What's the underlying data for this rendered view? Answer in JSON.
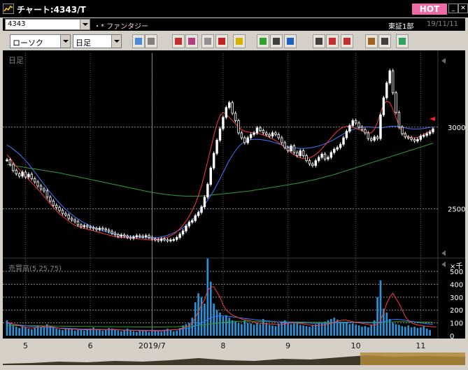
{
  "window": {
    "title": "チャート:4343/T",
    "hot_label": "HOT"
  },
  "symbol_bar": {
    "code": "4343",
    "name": "・* ファンタジー",
    "market": "東証1部",
    "date": "19/11/11"
  },
  "toolbar": {
    "chart_type": "ローソク",
    "period": "日足",
    "buttons": [
      "zoom-icon",
      "crosshair-icon",
      "stamp-icon",
      "search-chart-icon",
      "grid-icon",
      "split-icon",
      "alert-icon",
      "pencil-icon",
      "cursor-icon",
      "undo-icon",
      "candle-settings-icon",
      "compare-icon",
      "all-icon",
      "gear-icon",
      "wrench-icon",
      "palette-icon"
    ]
  },
  "price_panel": {
    "label": "日足",
    "price_ticks": [
      "3000",
      "2500"
    ]
  },
  "volume_panel": {
    "label": "売買高(5,25,75)",
    "unit": "×千",
    "ticks": [
      "500",
      "400",
      "300",
      "200",
      "100",
      "0"
    ]
  },
  "x_labels": [
    "5",
    "6",
    "2019/7",
    "8",
    "9",
    "10",
    "11"
  ],
  "colors": {
    "background": "#000000",
    "candle": "#ffffff",
    "ma_short": "#ff3a3a",
    "ma_mid": "#3a7bff",
    "ma_long": "#2ea02e",
    "volume_bar": "#2a94d8",
    "titlebar_hot": "#f06aa5"
  },
  "chart_data": {
    "type": "candlestick",
    "price_ylim": [
      2220,
      3410
    ],
    "candles": [
      2800,
      2772,
      2735,
      2715,
      2700,
      2725,
      2695,
      2712,
      2685,
      2665,
      2640,
      2622,
      2610,
      2572,
      2548,
      2522,
      2508,
      2490,
      2472,
      2462,
      2442,
      2432,
      2422,
      2402,
      2392,
      2397,
      2390,
      2385,
      2380,
      2374,
      2382,
      2376,
      2370,
      2362,
      2352,
      2342,
      2332,
      2340,
      2333,
      2326,
      2320,
      2328,
      2336,
      2333,
      2330,
      2336,
      2326,
      2316,
      2311,
      2306,
      2316,
      2311,
      2306,
      2310,
      2313,
      2325,
      2345,
      2365,
      2395,
      2418,
      2428,
      2458,
      2478,
      2512,
      2572,
      2650,
      2750,
      2840,
      2920,
      2990,
      3060,
      3120,
      3150,
      3085,
      3040,
      2965,
      2935,
      2905,
      2935,
      2955,
      2965,
      2995,
      2980,
      2965,
      2955,
      2945,
      2965,
      2955,
      2935,
      2905,
      2875,
      2855,
      2885,
      2845,
      2825,
      2855,
      2825,
      2795,
      2775,
      2765,
      2795,
      2815,
      2835,
      2805,
      2815,
      2845,
      2865,
      2875,
      2895,
      2935,
      2975,
      3010,
      3040,
      3025,
      3000,
      2985,
      2965,
      2930,
      2920,
      2940,
      2930,
      3075,
      3180,
      3270,
      3345,
      3210,
      3090,
      3000,
      2960,
      2940,
      2935,
      2925,
      2915,
      2925,
      2945,
      2950,
      2960,
      2970,
      2990
    ],
    "ma_short": [
      2830,
      2810,
      2785,
      2760,
      2740,
      2720,
      2700,
      2680,
      2660,
      2640,
      2620,
      2600,
      2575,
      2555,
      2530,
      2510,
      2490,
      2470,
      2455,
      2440,
      2425,
      2410,
      2400,
      2392,
      2385,
      2380,
      2375,
      2370,
      2366,
      2360,
      2355,
      2350,
      2345,
      2340,
      2335,
      2330,
      2327,
      2325,
      2324,
      2323,
      2322,
      2320,
      2318,
      2316,
      2314,
      2312,
      2310,
      2310,
      2312,
      2315,
      2318,
      2322,
      2328,
      2336,
      2346,
      2360,
      2378,
      2400,
      2425,
      2455,
      2490,
      2530,
      2580,
      2640,
      2710,
      2790,
      2870,
      2950,
      3020,
      3070,
      3090,
      3080,
      3060,
      3040,
      3020,
      3000,
      2985,
      2975,
      2970,
      2968,
      2965,
      2962,
      2958,
      2952,
      2946,
      2938,
      2928,
      2918,
      2905,
      2890,
      2875,
      2860,
      2845,
      2830,
      2820,
      2812,
      2808,
      2808,
      2812,
      2820,
      2832,
      2848,
      2868,
      2890,
      2912,
      2934,
      2956,
      2975,
      2990,
      3000,
      3005,
      3005,
      3000,
      2992,
      2985,
      2978,
      2970,
      2965,
      2965,
      2985,
      3030,
      3090,
      3140,
      3160,
      3150,
      3110,
      3060,
      3010,
      2970,
      2950,
      2940,
      2935,
      2935,
      2938,
      2945,
      2955,
      2965,
      2975,
      2985
    ],
    "ma_mid": [
      2890,
      2880,
      2865,
      2850,
      2835,
      2815,
      2795,
      2775,
      2750,
      2725,
      2700,
      2675,
      2650,
      2625,
      2600,
      2578,
      2555,
      2535,
      2515,
      2497,
      2480,
      2465,
      2450,
      2438,
      2426,
      2415,
      2405,
      2396,
      2388,
      2380,
      2372,
      2366,
      2360,
      2354,
      2349,
      2345,
      2342,
      2339,
      2336,
      2334,
      2332,
      2330,
      2328,
      2326,
      2324,
      2323,
      2322,
      2322,
      2323,
      2325,
      2328,
      2332,
      2338,
      2345,
      2353,
      2362,
      2372,
      2384,
      2398,
      2414,
      2432,
      2452,
      2474,
      2498,
      2524,
      2552,
      2582,
      2614,
      2648,
      2684,
      2722,
      2760,
      2796,
      2828,
      2856,
      2880,
      2898,
      2910,
      2918,
      2923,
      2925,
      2925,
      2924,
      2922,
      2919,
      2915,
      2910,
      2904,
      2898,
      2892,
      2886,
      2880,
      2876,
      2873,
      2871,
      2870,
      2870,
      2871,
      2873,
      2876,
      2880,
      2885,
      2891,
      2898,
      2906,
      2915,
      2925,
      2936,
      2947,
      2958,
      2968,
      2977,
      2985,
      2992,
      2997,
      3000,
      3001,
      3001,
      3000,
      2998,
      2996,
      2996,
      2998,
      3001,
      3004,
      3006,
      3006,
      3004,
      3000,
      2996,
      2992,
      2990,
      2989,
      2989,
      2990,
      2992,
      2995,
      2998,
      3002
    ],
    "ma_long": [
      2770,
      2768,
      2765,
      2762,
      2759,
      2756,
      2753,
      2750,
      2747,
      2744,
      2741,
      2738,
      2735,
      2732,
      2729,
      2726,
      2723,
      2720,
      2716,
      2712,
      2708,
      2704,
      2700,
      2696,
      2692,
      2688,
      2684,
      2680,
      2676,
      2672,
      2668,
      2664,
      2660,
      2656,
      2652,
      2648,
      2644,
      2640,
      2636,
      2632,
      2628,
      2624,
      2620,
      2616,
      2612,
      2608,
      2604,
      2601,
      2598,
      2595,
      2592,
      2589,
      2587,
      2585,
      2583,
      2581,
      2580,
      2579,
      2578,
      2578,
      2578,
      2578,
      2578,
      2579,
      2580,
      2582,
      2584,
      2586,
      2588,
      2590,
      2592,
      2594,
      2596,
      2598,
      2600,
      2602,
      2604,
      2606,
      2608,
      2611,
      2614,
      2617,
      2620,
      2623,
      2626,
      2629,
      2632,
      2635,
      2638,
      2641,
      2644,
      2647,
      2650,
      2653,
      2656,
      2660,
      2664,
      2668,
      2672,
      2676,
      2680,
      2685,
      2690,
      2695,
      2700,
      2705,
      2710,
      2716,
      2722,
      2728,
      2734,
      2740,
      2746,
      2752,
      2758,
      2764,
      2770,
      2776,
      2782,
      2788,
      2794,
      2800,
      2806,
      2812,
      2818,
      2824,
      2830,
      2836,
      2842,
      2848,
      2854,
      2860,
      2866,
      2872,
      2878,
      2884,
      2890,
      2896,
      2902
    ],
    "volume": [
      120,
      95,
      85,
      70,
      60,
      75,
      65,
      55,
      50,
      60,
      80,
      70,
      65,
      90,
      75,
      60,
      55,
      50,
      45,
      55,
      60,
      50,
      40,
      45,
      50,
      40,
      45,
      55,
      65,
      50,
      45,
      40,
      50,
      60,
      55,
      45,
      40,
      35,
      45,
      55,
      40,
      35,
      30,
      40,
      45,
      35,
      30,
      45,
      40,
      35,
      30,
      40,
      55,
      45,
      35,
      40,
      60,
      80,
      90,
      100,
      140,
      260,
      330,
      300,
      250,
      600,
      420,
      250,
      200,
      180,
      150,
      160,
      140,
      120,
      110,
      100,
      90,
      120,
      100,
      95,
      85,
      100,
      90,
      130,
      95,
      85,
      80,
      75,
      95,
      110,
      120,
      100,
      90,
      95,
      110,
      85,
      80,
      75,
      70,
      85,
      90,
      100,
      95,
      110,
      120,
      130,
      140,
      125,
      110,
      100,
      105,
      90,
      95,
      85,
      80,
      70,
      75,
      65,
      85,
      120,
      300,
      430,
      210,
      180,
      130,
      100,
      90,
      85,
      75,
      70,
      80,
      65,
      70,
      60,
      65,
      75,
      55,
      45
    ],
    "vol_ma_short": [
      105,
      100,
      90,
      85,
      78,
      72,
      66,
      62,
      60,
      62,
      66,
      70,
      72,
      74,
      72,
      68,
      62,
      58,
      55,
      53,
      52,
      51,
      50,
      48,
      47,
      46,
      46,
      47,
      49,
      50,
      50,
      49,
      48,
      48,
      49,
      49,
      47,
      44,
      42,
      42,
      42,
      41,
      40,
      39,
      38,
      38,
      38,
      38,
      38,
      37,
      36,
      38,
      42,
      45,
      47,
      48,
      52,
      60,
      68,
      78,
      98,
      140,
      190,
      240,
      280,
      350,
      380,
      380,
      340,
      300,
      240,
      200,
      180,
      160,
      150,
      140,
      130,
      125,
      120,
      115,
      105,
      100,
      96,
      96,
      94,
      92,
      90,
      88,
      86,
      88,
      92,
      96,
      98,
      100,
      98,
      96,
      92,
      88,
      84,
      80,
      78,
      80,
      82,
      85,
      90,
      96,
      104,
      112,
      118,
      122,
      120,
      116,
      110,
      104,
      100,
      96,
      92,
      88,
      84,
      82,
      88,
      120,
      180,
      250,
      300,
      330,
      290,
      250,
      200,
      150,
      120,
      100,
      90,
      84,
      80,
      76,
      74,
      72,
      70,
      68
    ],
    "vol_ma_mid": [
      95,
      93,
      90,
      87,
      84,
      81,
      78,
      75,
      73,
      71,
      69,
      67,
      65,
      64,
      63,
      62,
      61,
      60,
      59,
      58,
      57,
      56,
      55,
      54,
      53,
      52,
      51,
      50,
      49,
      48,
      48,
      47,
      47,
      46,
      46,
      46,
      45,
      45,
      44,
      44,
      44,
      43,
      43,
      43,
      42,
      42,
      42,
      42,
      42,
      42,
      42,
      43,
      44,
      45,
      46,
      48,
      50,
      53,
      57,
      62,
      68,
      76,
      86,
      98,
      112,
      126,
      138,
      148,
      152,
      154,
      154,
      152,
      150,
      147,
      144,
      141,
      138,
      135,
      132,
      129,
      126,
      123,
      120,
      118,
      116,
      114,
      112,
      110,
      108,
      107,
      106,
      105,
      104,
      103,
      102,
      101,
      100,
      99,
      98,
      97,
      96,
      96,
      96,
      97,
      98,
      99,
      100,
      101,
      102,
      103,
      104,
      105,
      105,
      104,
      103,
      102,
      101,
      100,
      99,
      98,
      100,
      104,
      110,
      116,
      122,
      126,
      128,
      127,
      124,
      120,
      116,
      112,
      108,
      104,
      100,
      97,
      94,
      91,
      88
    ],
    "vol_ma_long": [
      80,
      80,
      80,
      79,
      79,
      79,
      78,
      78,
      78,
      77,
      77,
      77,
      76,
      76,
      76,
      75,
      75,
      75,
      74,
      74,
      74,
      73,
      73,
      73,
      72,
      72,
      72,
      72,
      71,
      71,
      71,
      70,
      70,
      70,
      70,
      70,
      69,
      69,
      69,
      69,
      69,
      68,
      68,
      68,
      68,
      68,
      68,
      68,
      68,
      68,
      68,
      68,
      69,
      69,
      70,
      70,
      71,
      72,
      73,
      74,
      76,
      78,
      80,
      82,
      85,
      88,
      91,
      94,
      97,
      100,
      103,
      106,
      108,
      110,
      111,
      112,
      113,
      113,
      113,
      113,
      113,
      112,
      112,
      111,
      111,
      110,
      110,
      109,
      109,
      108,
      108,
      107,
      107,
      107,
      106,
      106,
      106,
      105,
      105,
      105,
      104,
      104,
      104,
      104,
      104,
      104,
      105,
      105,
      105,
      106,
      106,
      106,
      106,
      106,
      106,
      105,
      105,
      105,
      104,
      104,
      104,
      105,
      106,
      107,
      108,
      109,
      110,
      110,
      110,
      109,
      109,
      108,
      108,
      107,
      107,
      106,
      106,
      105,
      105
    ],
    "price_ticks": [
      3000,
      2500
    ],
    "volume_ylim": [
      0,
      560
    ],
    "volume_ticks": [
      500,
      400,
      300,
      200,
      100,
      0
    ],
    "x_tick_candle_index": [
      6,
      27,
      47,
      70,
      91,
      113,
      134
    ]
  }
}
